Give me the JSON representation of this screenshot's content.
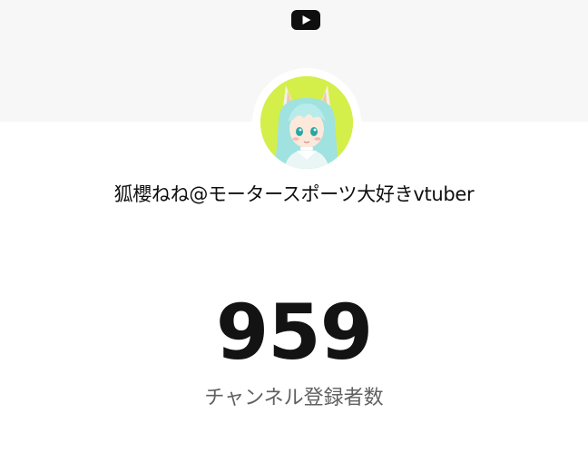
{
  "header": {
    "logo_icon": "youtube-logo-icon"
  },
  "channel": {
    "name": "狐櫻ねね@モータースポーツ大好きvtuber",
    "avatar_icon": "channel-avatar",
    "subscriber_count": "959",
    "subscriber_label": "チャンネル登録者数"
  },
  "colors": {
    "banner": "#f7f7f7",
    "background": "#ffffff",
    "avatar_bg": "#d4ef4a",
    "count_text": "#131313",
    "label_text": "#606060"
  }
}
